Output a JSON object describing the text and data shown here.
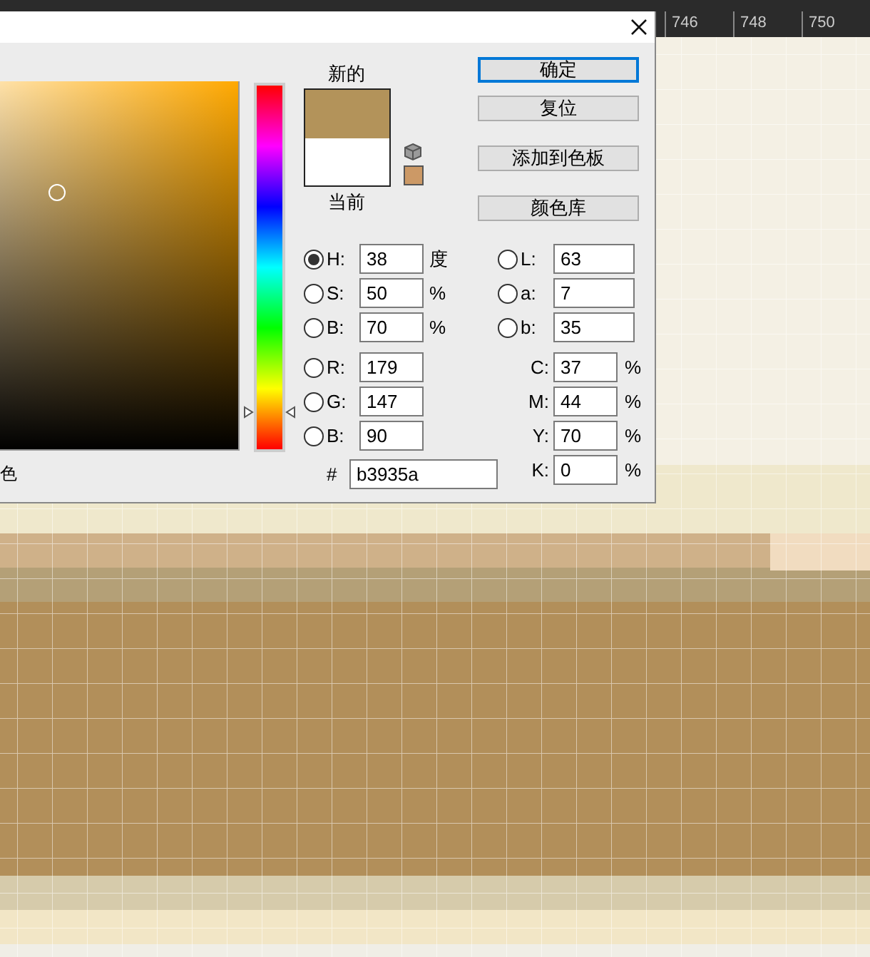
{
  "ruler": {
    "labels": [
      "746",
      "748",
      "750"
    ]
  },
  "dialog": {
    "cut_label": "色",
    "hue_slider": {
      "level": 0.11
    },
    "new_label": "新的",
    "current_label": "当前",
    "swatches": [
      {
        "kind": "new",
        "color": "#b3935a"
      },
      {
        "kind": "current",
        "color": "#ffffff"
      },
      {
        "kind": "websafe",
        "color": "#cc9966"
      }
    ],
    "buttons": [
      {
        "label": "确定",
        "default": true
      },
      {
        "label": "复位",
        "default": false
      },
      {
        "label": "添加到色板",
        "default": false
      },
      {
        "label": "颜色库",
        "default": false
      }
    ],
    "hsb_rgb": [
      {
        "label": "H:",
        "value": "38",
        "unit": "度",
        "selected": true
      },
      {
        "label": "S:",
        "value": "50",
        "unit": "%",
        "selected": false
      },
      {
        "label": "B:",
        "value": "70",
        "unit": "%",
        "selected": false
      },
      {
        "label": "R:",
        "value": "179",
        "selected": false
      },
      {
        "label": "G:",
        "value": "147",
        "selected": false
      },
      {
        "label": "B:",
        "value": "90",
        "selected": false
      }
    ],
    "lab": [
      {
        "label": "L:",
        "value": "63",
        "selected": false
      },
      {
        "label": "a:",
        "value": "7",
        "selected": false
      },
      {
        "label": "b:",
        "value": "35",
        "selected": false
      }
    ],
    "cmyk": [
      {
        "label": "C:",
        "value": "37",
        "unit": "%"
      },
      {
        "label": "M:",
        "value": "44",
        "unit": "%"
      },
      {
        "label": "Y:",
        "value": "70",
        "unit": "%"
      },
      {
        "label": "K:",
        "value": "0",
        "unit": "%"
      }
    ],
    "hex": {
      "label": "#",
      "value": "b3935a"
    }
  }
}
